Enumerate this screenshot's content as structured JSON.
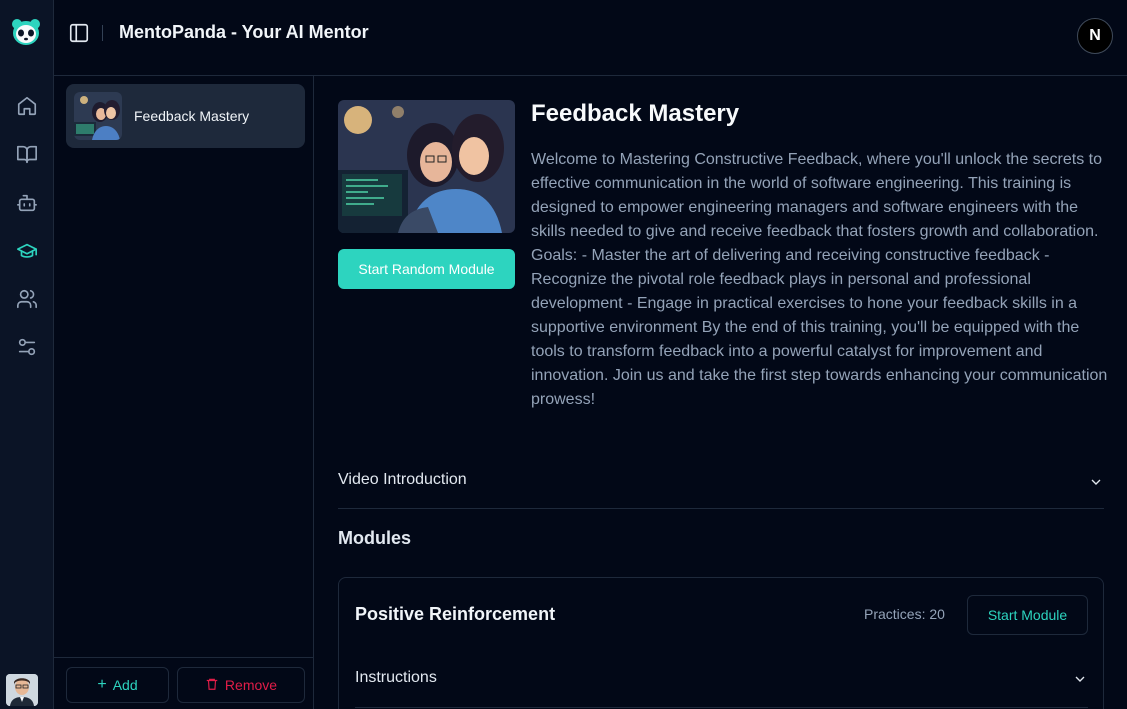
{
  "header": {
    "title": "MentoPanda - Your AI Mentor",
    "avatar_letter": "N"
  },
  "rail": {
    "items": [
      {
        "name": "home-icon",
        "active": false
      },
      {
        "name": "book-open-icon",
        "active": false
      },
      {
        "name": "bot-icon",
        "active": false
      },
      {
        "name": "graduation-cap-icon",
        "active": true
      },
      {
        "name": "users-icon",
        "active": false
      },
      {
        "name": "sliders-icon",
        "active": false
      }
    ]
  },
  "list": {
    "items": [
      {
        "label": "Feedback Mastery"
      }
    ],
    "add_label": "Add",
    "remove_label": "Remove"
  },
  "training": {
    "title": "Feedback Mastery",
    "start_random_label": "Start Random Module",
    "description": "Welcome to Mastering Constructive Feedback, where you'll unlock the secrets to effective communication in the world of software engineering. This training is designed to empower engineering managers and software engineers with the skills needed to give and receive feedback that fosters growth and collaboration. Goals: - Master the art of delivering and receiving constructive feedback - Recognize the pivotal role feedback plays in personal and professional development - Engage in practical exercises to hone your feedback skills in a supportive environment By the end of this training, you'll be equipped with the tools to transform feedback into a powerful catalyst for improvement and innovation. Join us and take the first step towards enhancing your communication prowess!",
    "video_intro_label": "Video Introduction",
    "modules_heading": "Modules"
  },
  "module": {
    "title": "Positive Reinforcement",
    "practices": "Practices: 20",
    "start_label": "Start Module",
    "instructions_label": "Instructions"
  },
  "colors": {
    "accent": "#2dd4bf",
    "danger": "#e11d48",
    "background": "#020817",
    "border": "#1e293b"
  }
}
